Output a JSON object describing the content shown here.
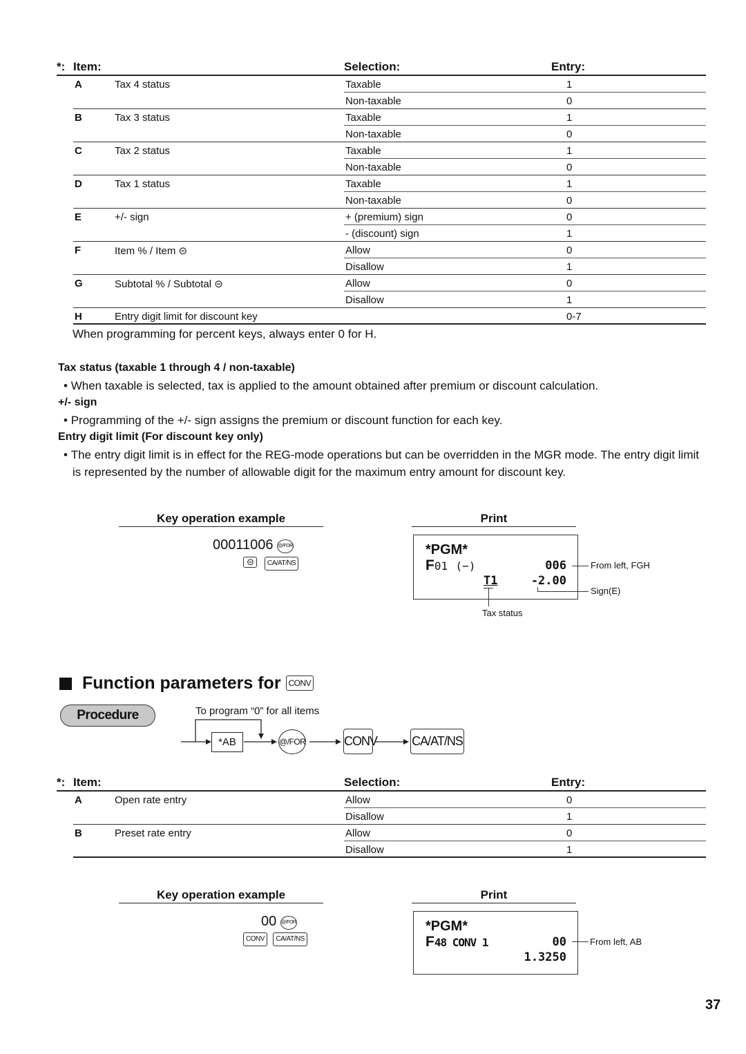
{
  "table1": {
    "headers": {
      "asterisk": "*:",
      "item": "Item:",
      "selection": "Selection:",
      "entry": "Entry:"
    },
    "rows": [
      {
        "letter": "A",
        "desc": "Tax 4 status",
        "selection": "Taxable",
        "entry": "1"
      },
      {
        "letter": "",
        "desc": "",
        "selection": "Non-taxable",
        "entry": "0"
      },
      {
        "letter": "B",
        "desc": "Tax 3 status",
        "selection": "Taxable",
        "entry": "1"
      },
      {
        "letter": "",
        "desc": "",
        "selection": "Non-taxable",
        "entry": "0"
      },
      {
        "letter": "C",
        "desc": "Tax 2 status",
        "selection": "Taxable",
        "entry": "1"
      },
      {
        "letter": "",
        "desc": "",
        "selection": "Non-taxable",
        "entry": "0"
      },
      {
        "letter": "D",
        "desc": "Tax 1 status",
        "selection": "Taxable",
        "entry": "1"
      },
      {
        "letter": "",
        "desc": "",
        "selection": "Non-taxable",
        "entry": "0"
      },
      {
        "letter": "E",
        "desc": "+/- sign",
        "selection": "+ (premium) sign",
        "entry": "0"
      },
      {
        "letter": "",
        "desc": "",
        "selection": "- (discount) sign",
        "entry": "1"
      },
      {
        "letter": "F",
        "desc": "Item % / Item ⊝",
        "selection": "Allow",
        "entry": "0"
      },
      {
        "letter": "",
        "desc": "",
        "selection": "Disallow",
        "entry": "1"
      },
      {
        "letter": "G",
        "desc": "Subtotal % / Subtotal ⊝",
        "selection": "Allow",
        "entry": "0"
      },
      {
        "letter": "",
        "desc": "",
        "selection": "Disallow",
        "entry": "1"
      },
      {
        "letter": "H",
        "desc": "Entry digit limit for discount key",
        "selection": "",
        "entry": "0-7"
      }
    ],
    "footnote": "When programming for percent keys, always enter 0 for H."
  },
  "notes": [
    {
      "heading": "Tax status (taxable 1 through 4 / non-taxable)",
      "bullets": [
        "When taxable is selected, tax is applied to the amount obtained after premium or discount calculation."
      ]
    },
    {
      "heading": "+/- sign",
      "bullets": [
        "Programming of the +/- sign assigns the premium or discount function for each key."
      ]
    },
    {
      "heading": "Entry digit limit (For discount key only)",
      "bullets": [
        "The entry digit limit is in effect for the REG-mode operations but can be overridden in the MGR mode.  The entry digit limit is represented by the number of allowable digit for the maximum entry amount for discount key."
      ]
    }
  ],
  "example1": {
    "key_heading": "Key operation example",
    "print_heading": "Print",
    "digits": "00011006",
    "keys": {
      "at_for": "@/FOR",
      "minus": "⊝",
      "ca": "CA/AT/NS"
    },
    "receipt": {
      "line1": "*PGM*",
      "line2_prefix": "F",
      "line2_code": "01",
      "line2_label": "(−)",
      "line2_value": "006",
      "line3_tax": "T1",
      "line3_value": "-2.00"
    },
    "callouts": {
      "fgh": "From left, FGH",
      "sign": "Sign(E)",
      "tax": "Tax status"
    }
  },
  "section2": {
    "title": "Function parameters for",
    "title_key": "CONV",
    "procedure_label": "Procedure",
    "flow": {
      "loop_note": "To program “0” for all items",
      "step_ab": "*AB",
      "step_at_for": "@/FOR",
      "step_conv": "CONV",
      "step_ca": "CA/AT/NS"
    }
  },
  "table2": {
    "headers": {
      "asterisk": "*:",
      "item": "Item:",
      "selection": "Selection:",
      "entry": "Entry:"
    },
    "rows": [
      {
        "letter": "A",
        "desc": "Open rate entry",
        "selection": "Allow",
        "entry": "0"
      },
      {
        "letter": "",
        "desc": "",
        "selection": "Disallow",
        "entry": "1"
      },
      {
        "letter": "B",
        "desc": "Preset rate entry",
        "selection": "Allow",
        "entry": "0"
      },
      {
        "letter": "",
        "desc": "",
        "selection": "Disallow",
        "entry": "1"
      }
    ]
  },
  "example2": {
    "key_heading": "Key operation example",
    "print_heading": "Print",
    "digits": "00",
    "keys": {
      "at_for": "@/FOR",
      "conv": "CONV",
      "ca": "CA/AT/NS"
    },
    "receipt": {
      "line1": "*PGM*",
      "line2_prefix": "F",
      "line2_code": "48 CONV 1",
      "line2_value": "00",
      "line3_value": "1.3250"
    },
    "callouts": {
      "ab": "From left, AB"
    }
  },
  "page_number": "37"
}
